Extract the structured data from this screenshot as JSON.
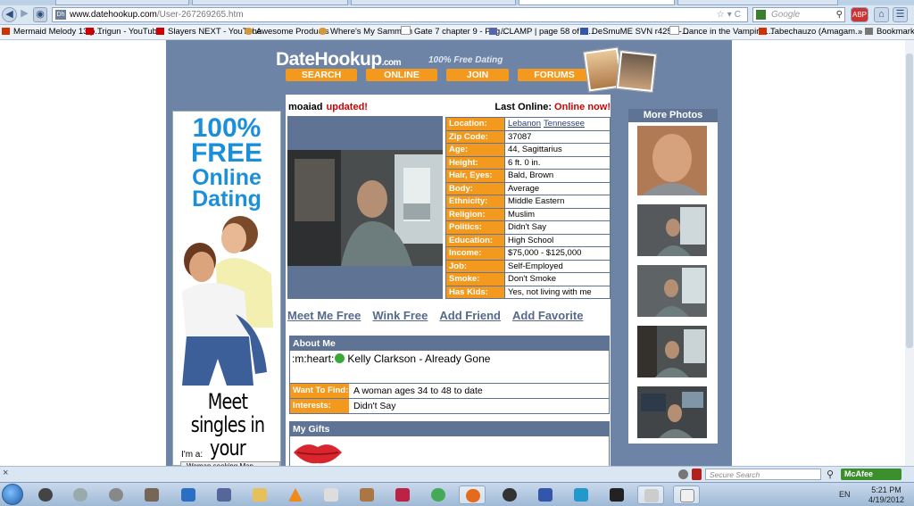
{
  "browser": {
    "url_host": "www.datehookup.com",
    "url_path": "/User-267269265.htm",
    "favicon_text": "Dh",
    "search_engine": "Google",
    "bookmarks": [
      {
        "label": "Mermaid Melody 13 p...",
        "icon": "page-icon",
        "color": "#cc3300"
      },
      {
        "label": "Trigun - YouTube",
        "icon": "youtube-icon",
        "color": "#cc0000"
      },
      {
        "label": "Slayers NEXT - YouTube",
        "icon": "youtube-icon",
        "color": "#cc0000"
      },
      {
        "label": "Awesome Products",
        "icon": "sandwich-icon",
        "color": "#d09a3a"
      },
      {
        "label": "Where's My Sammich",
        "icon": "sandwich-icon",
        "color": "#d09a3a"
      },
      {
        "label": "Gate 7 chapter 9 - Pag...",
        "icon": "page-icon",
        "color": "#cccccc"
      },
      {
        "label": "/CLAMP | page 58 of 1...",
        "icon": "page-icon",
        "color": "#5566aa"
      },
      {
        "label": "DeSmuME SVN r4256 -...",
        "icon": "page-icon",
        "color": "#3355aa"
      },
      {
        "label": "Dance in the Vampire ...",
        "icon": "page-icon",
        "color": "#cccccc"
      },
      {
        "label": "Tabechauzo (Amagam...",
        "icon": "page-icon",
        "color": "#cc3300"
      }
    ],
    "bookmarks_menu": "Bookmarks",
    "status_search_placeholder": "Secure Search",
    "mcafee_label": "McAfee"
  },
  "site": {
    "logo": "DateHookup",
    "logo_suffix": ".com",
    "tagline": "100% Free Dating",
    "menu": [
      "SEARCH",
      "ONLINE",
      "JOIN",
      "FORUMS"
    ],
    "accent": "#f39a1e",
    "panel_color": "#5f7394"
  },
  "ad": {
    "line1": "100%",
    "line2": "FREE",
    "line3": "Online",
    "line4": "Dating",
    "meet": "Meet singles in your area!",
    "im_a": "I'm a:",
    "seeking": "Woman seeking Man"
  },
  "profile": {
    "username": "moaiad",
    "updated": "updated!",
    "last_online_label": "Last Online:",
    "last_online_value": "Online now!",
    "details": [
      {
        "key": "Location:",
        "value": "",
        "links": [
          "Lebanon",
          "Tennessee"
        ]
      },
      {
        "key": "Zip Code:",
        "value": "37087"
      },
      {
        "key": "Age:",
        "value": "44, Sagittarius"
      },
      {
        "key": "Height:",
        "value": "6 ft. 0 in."
      },
      {
        "key": "Hair, Eyes:",
        "value": "Bald, Brown"
      },
      {
        "key": "Body:",
        "value": "Average"
      },
      {
        "key": "Ethnicity:",
        "value": "Middle Eastern"
      },
      {
        "key": "Religion:",
        "value": "Muslim"
      },
      {
        "key": "Politics:",
        "value": "Didn't Say"
      },
      {
        "key": "Education:",
        "value": "High School"
      },
      {
        "key": "Income:",
        "value": "$75,000 - $125,000"
      },
      {
        "key": "Job:",
        "value": "Self-Employed"
      },
      {
        "key": "Smoke:",
        "value": "Don't Smoke"
      },
      {
        "key": "Has Kids:",
        "value": "Yes, not living with me"
      }
    ],
    "actions": [
      "Meet Me Free",
      "Wink Free",
      "Add Friend",
      "Add Favorite"
    ],
    "about_title": "About Me",
    "about_text": ":m:heart:",
    "about_text2": "Kelly Clarkson - Already Gone",
    "want_label": "Want To Find:",
    "want_value": "A woman ages 34 to 48 to date",
    "interests_label": "Interests:",
    "interests_value": "Didn't Say",
    "gifts_title": "My Gifts"
  },
  "more_photos": {
    "title": "More Photos",
    "count": 5
  },
  "taskbar": {
    "lang": "EN",
    "time": "5:21 PM",
    "date": "4/19/2012",
    "icons": [
      "hdd-icon",
      "webcam-icon",
      "film-reel-icon",
      "gimp-icon",
      "teamviewer-icon",
      "app-icon",
      "folder-icon",
      "vlc-icon",
      "gamepad-icon",
      "tools-icon",
      "pj64-icon",
      "puzzle-icon",
      "firefox-icon",
      "obs-icon",
      "dolphin-icon",
      "figure-icon",
      "meter-icon",
      "paint-icon",
      "notepad-icon"
    ]
  }
}
